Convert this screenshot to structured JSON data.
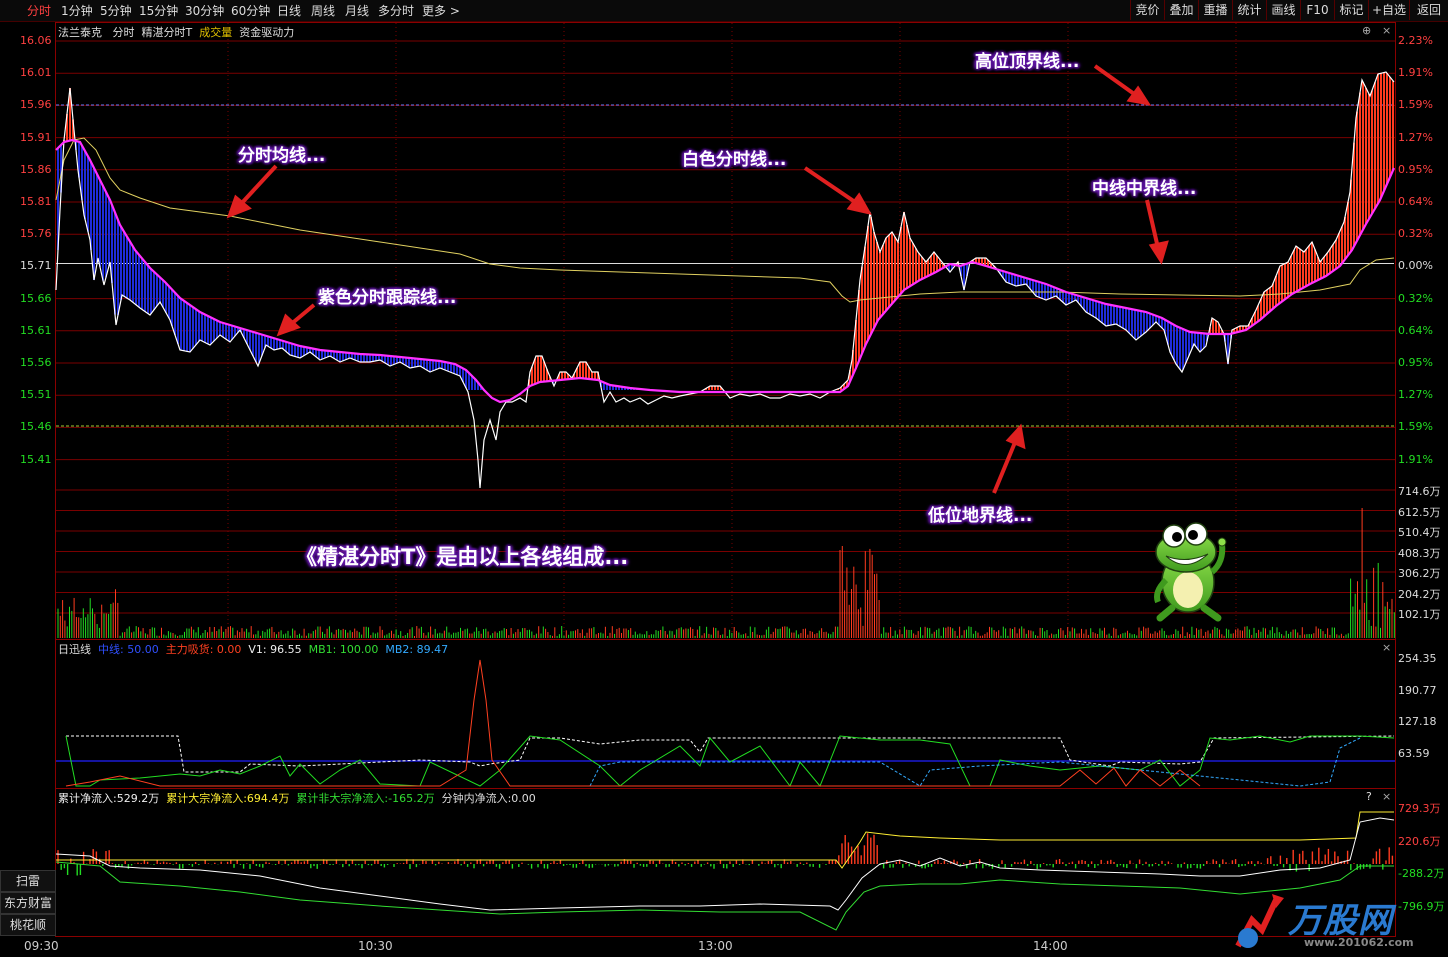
{
  "toolbar": {
    "tabs": [
      "分时",
      "1分钟",
      "5分钟",
      "15分钟",
      "30分钟",
      "60分钟",
      "日线",
      "周线",
      "月线",
      "多分时",
      "更多 >"
    ],
    "active_tab": "分时",
    "right_buttons": [
      "竞价",
      "叠加",
      "重播",
      "统计",
      "画线",
      "F10",
      "标记",
      "+自选",
      "返回"
    ]
  },
  "main_panel": {
    "stock_name": "法兰泰克",
    "labels": [
      "分时",
      "精湛分时T",
      "成交量",
      "资金驱动力"
    ],
    "left_prices": [
      "16.06",
      "16.01",
      "15.96",
      "15.91",
      "15.86",
      "15.81",
      "15.76",
      "15.71",
      "15.66",
      "15.61",
      "15.56",
      "15.51",
      "15.46",
      "15.41"
    ],
    "right_pcts": [
      "2.23%",
      "1.91%",
      "1.59%",
      "1.27%",
      "0.95%",
      "0.64%",
      "0.32%",
      "0.00%",
      "0.32%",
      "0.64%",
      "0.95%",
      "1.27%",
      "1.59%",
      "1.91%"
    ],
    "volume_labels": [
      "714.6万",
      "612.5万",
      "510.4万",
      "408.3万",
      "306.2万",
      "204.2万",
      "102.1万"
    ]
  },
  "annotations": {
    "avg_line": "分时均线...",
    "purple_line": "紫色分时跟踪线...",
    "white_line": "白色分时线...",
    "high_line": "高位顶界线...",
    "mid_line": "中线中界线...",
    "low_line": "低位地界线...",
    "summary": "《精湛分时T》是由以上各线组成..."
  },
  "indicator_panel": {
    "name": "日迅线",
    "mid": "中线: 50.00",
    "main_absorb": "主力吸货: 0.00",
    "v1": "V1: 96.55",
    "mb1": "MB1: 100.00",
    "mb2": "MB2: 89.47",
    "scale": [
      "254.35",
      "190.77",
      "127.18",
      "63.59"
    ]
  },
  "flow_panel": {
    "cum_inflow": "累计净流入:529.2万",
    "cum_block": "累计大宗净流入:694.4万",
    "cum_nonblock": "累计非大宗净流入:-165.2万",
    "minute_inflow": "分钟内净流入:0.00",
    "scale": [
      "729.3万",
      "220.6万",
      "-288.2万",
      "-796.9万"
    ]
  },
  "side_buttons": [
    "扫雷",
    "东方财富",
    "桃花顺"
  ],
  "time_axis": [
    "09:30",
    "10:30",
    "13:00",
    "14:00"
  ],
  "watermark": {
    "name": "万股网",
    "url": "www.201062.com"
  }
}
